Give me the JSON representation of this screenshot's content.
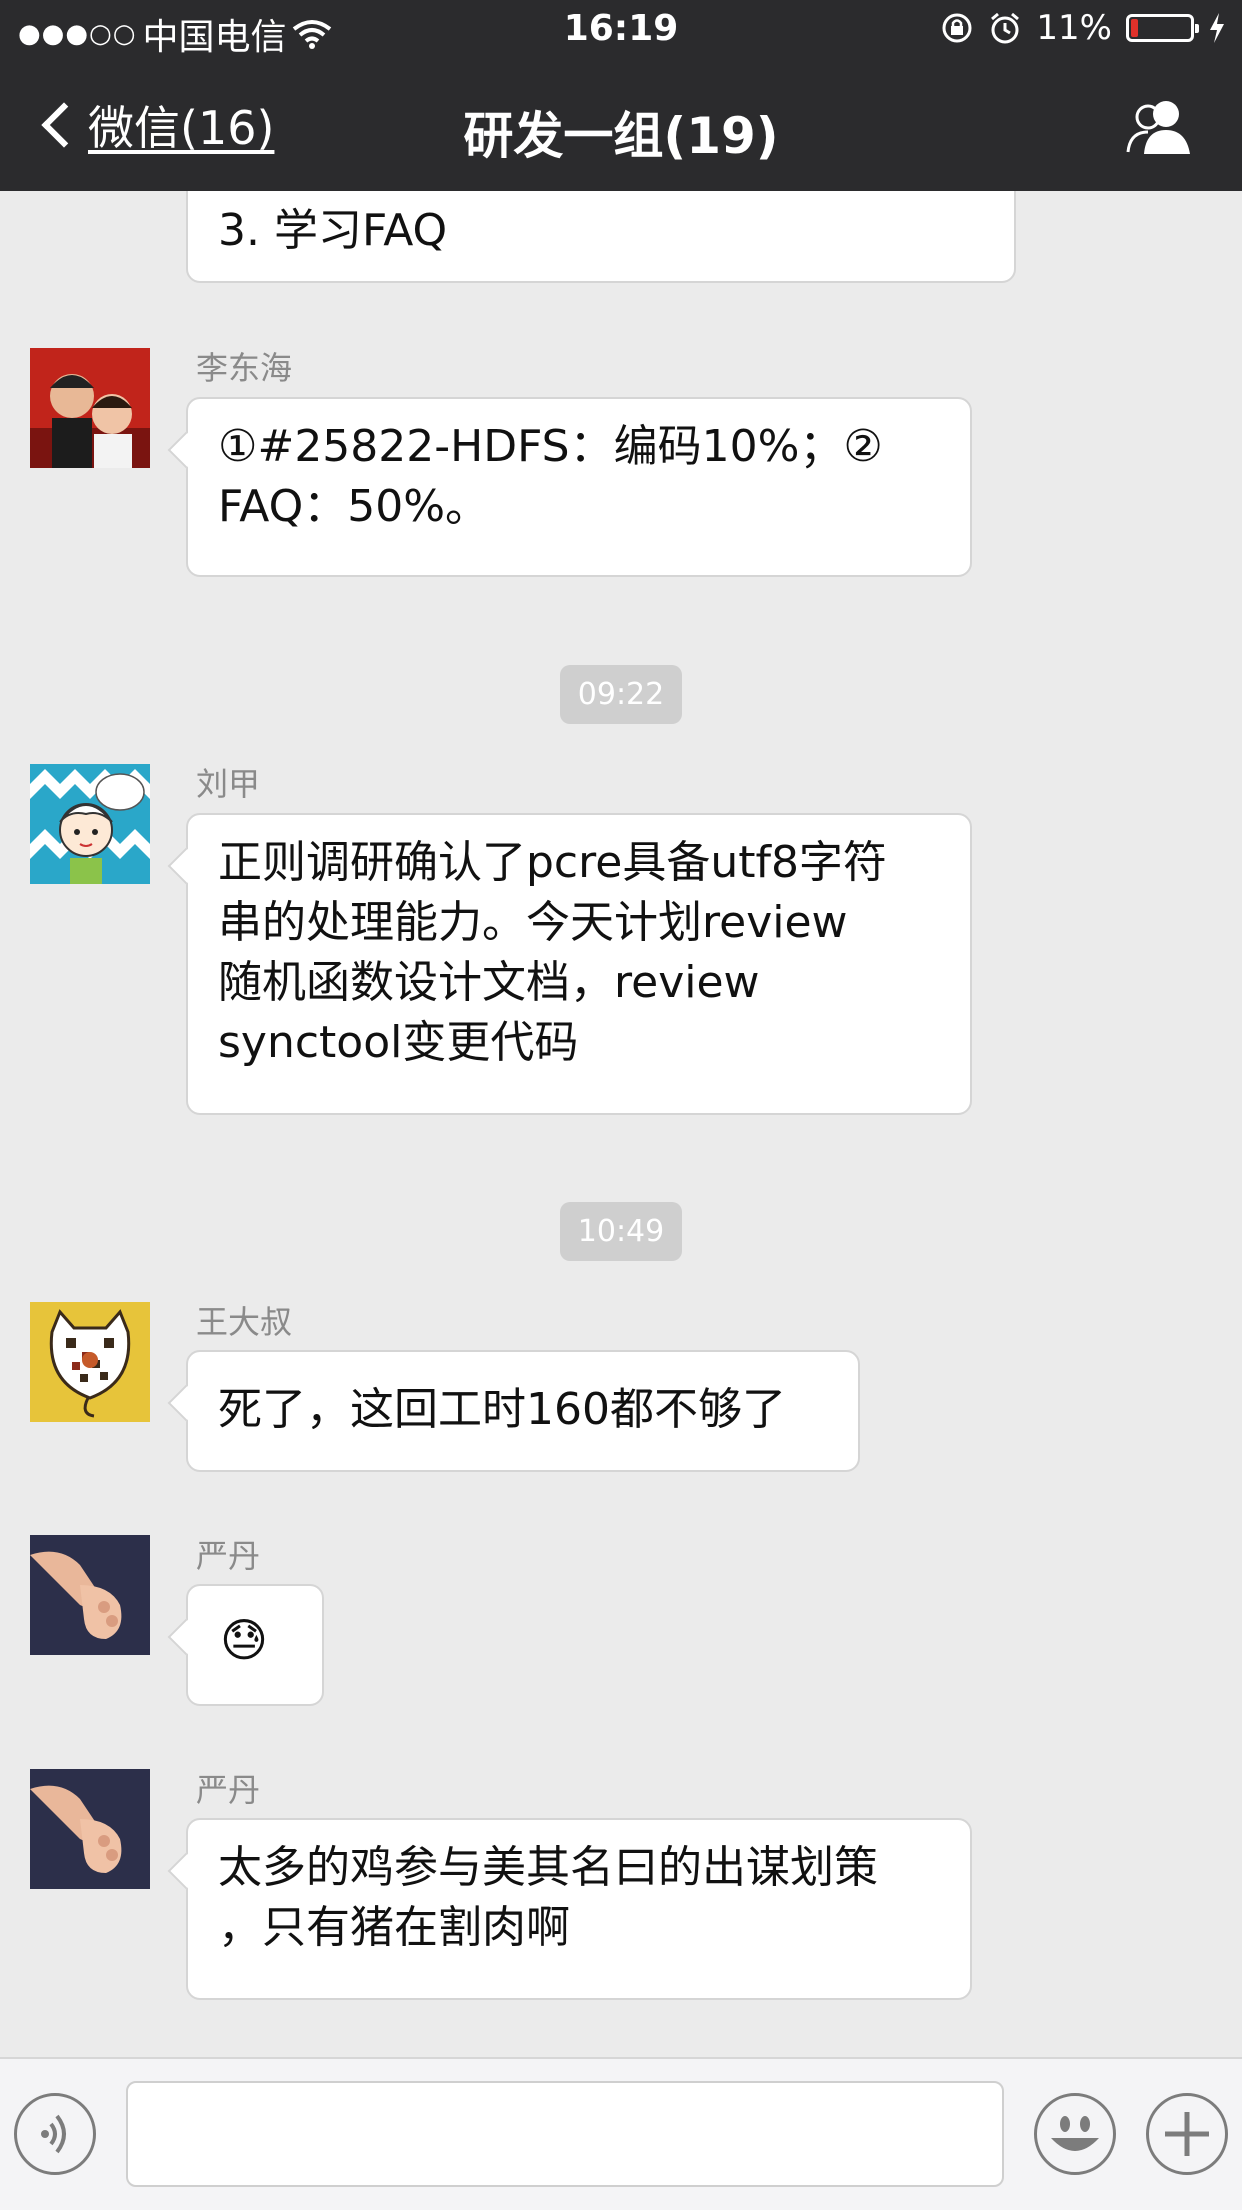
{
  "status_bar": {
    "signal": "●●●○○",
    "carrier": "中国电信",
    "time": "16:19",
    "battery_percent": "11%"
  },
  "nav": {
    "back_label": "微信(16)",
    "title": "研发一组(19)"
  },
  "messages": {
    "m0": {
      "text": "3. 学习FAQ"
    },
    "m1": {
      "sender": "李东海",
      "text_line1": "①#25822-HDFS：编码10%；②",
      "text_line2": "FAQ：50%。"
    },
    "t1": "09:22",
    "m2": {
      "sender": "刘甲",
      "line1": "正则调研确认了pcre具备utf8字符",
      "line2": "串的处理能力。今天计划review",
      "line3": "随机函数设计文档，review",
      "line4": "synctool变更代码"
    },
    "t2": "10:49",
    "m3": {
      "sender": "王大叔",
      "text": "死了，这回工时160都不够了"
    },
    "m4": {
      "sender": "严丹",
      "emoji": "😓"
    },
    "m5": {
      "sender": "严丹",
      "line1": "太多的鸡参与美其名曰的出谋划策",
      "line2": "，只有猪在割肉啊"
    }
  },
  "colors": {
    "header_bg": "#2b2b2d",
    "chat_bg": "#ebebeb",
    "bubble_bg": "#ffffff",
    "battery_low": "#e0312a"
  },
  "icons": [
    "wifi-icon",
    "rotation-lock-icon",
    "alarm-icon",
    "charging-icon",
    "back-chevron-icon",
    "group-members-icon",
    "voice-icon",
    "emoji-icon",
    "plus-icon"
  ]
}
